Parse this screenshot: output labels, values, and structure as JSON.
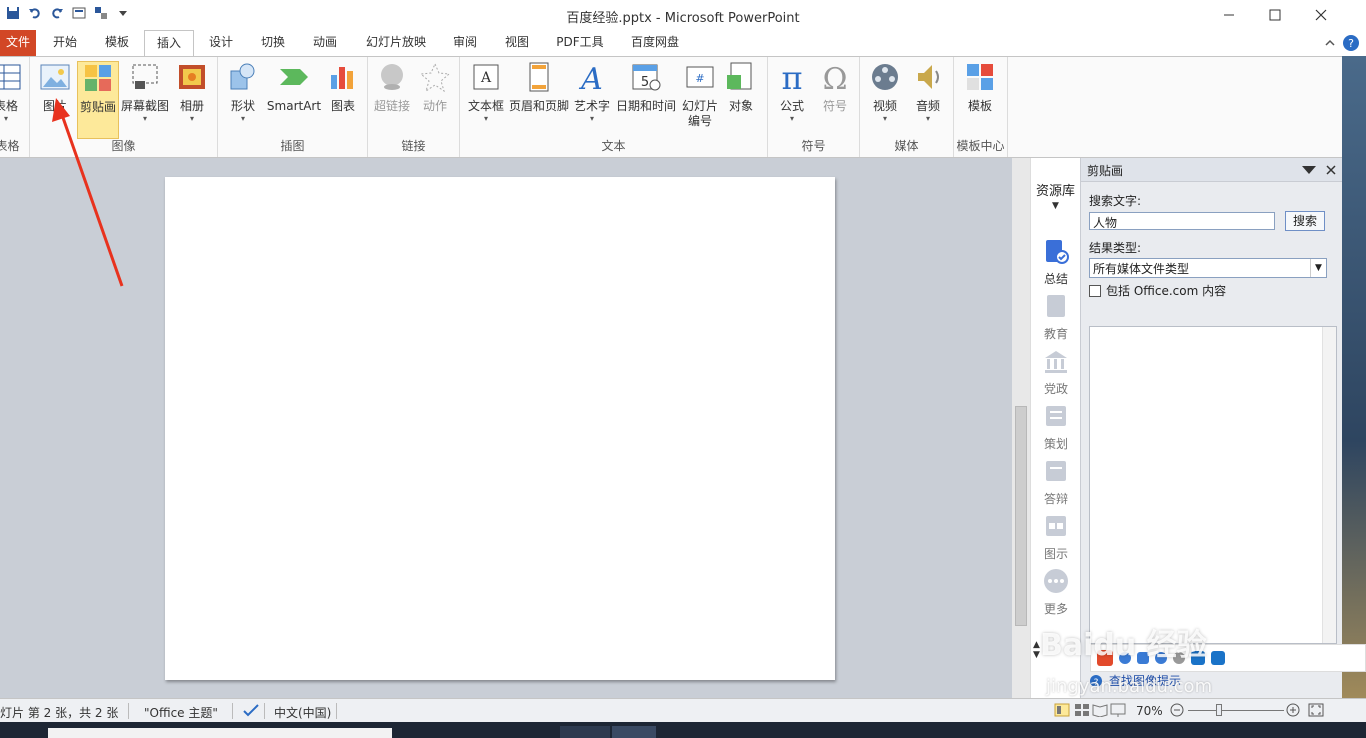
{
  "window": {
    "title": "百度经验.pptx - Microsoft PowerPoint",
    "controls": [
      "minimize",
      "maximize",
      "close"
    ]
  },
  "tabs": [
    {
      "label": "文件",
      "active": false
    },
    {
      "label": "开始",
      "active": false
    },
    {
      "label": "模板",
      "active": false
    },
    {
      "label": "插入",
      "active": true
    },
    {
      "label": "设计",
      "active": false
    },
    {
      "label": "切换",
      "active": false
    },
    {
      "label": "动画",
      "active": false
    },
    {
      "label": "幻灯片放映",
      "active": false
    },
    {
      "label": "审阅",
      "active": false
    },
    {
      "label": "视图",
      "active": false
    },
    {
      "label": "PDF工具",
      "active": false
    },
    {
      "label": "百度网盘",
      "active": false
    }
  ],
  "ribbon": {
    "groups": {
      "table": "表格",
      "images": "图像",
      "illustrations": "插图",
      "links": "链接",
      "text": "文本",
      "symbols": "符号",
      "media": "媒体",
      "templates": "模板中心"
    },
    "buttons": {
      "table": "表格",
      "picture": "图片",
      "clipart": "剪贴画",
      "screenshot": "屏幕截图",
      "album": "相册",
      "shapes": "形状",
      "smartart": "SmartArt",
      "chart": "图表",
      "hyperlink": "超链接",
      "action": "动作",
      "textbox": "文本框",
      "header_footer": "页眉和页脚",
      "wordart": "艺术字",
      "datetime": "日期和时间",
      "slide_number_1": "幻灯片",
      "slide_number_2": "编号",
      "object": "对象",
      "equation": "公式",
      "symbol": "符号",
      "video": "视频",
      "audio": "音频",
      "template": "模板"
    }
  },
  "resource_library": {
    "title": "资源库",
    "items": [
      "总结",
      "教育",
      "党政",
      "策划",
      "答辩",
      "图示",
      "更多"
    ]
  },
  "clip_pane": {
    "title": "剪贴画",
    "search_label": "搜索文字:",
    "search_value": "人物",
    "search_button": "搜索",
    "result_type_label": "结果类型:",
    "result_type_value": "所有媒体文件类型",
    "include_label": "包括 Office.com 内容",
    "hint_link": "查找图像提示"
  },
  "statusbar": {
    "slide_info": "灯片 第 2 张，共 2 张",
    "theme": "\"Office 主题\"",
    "language": "中文(中国)",
    "zoom": "70%"
  },
  "watermark": {
    "brand": "Baidu 经验",
    "url": "jingyan.baidu.com"
  },
  "colors": {
    "file_tab": "#d24726",
    "selected_button": "#fde99a",
    "workspace": "#c9ced6",
    "annotation_arrow": "#e8321e"
  }
}
